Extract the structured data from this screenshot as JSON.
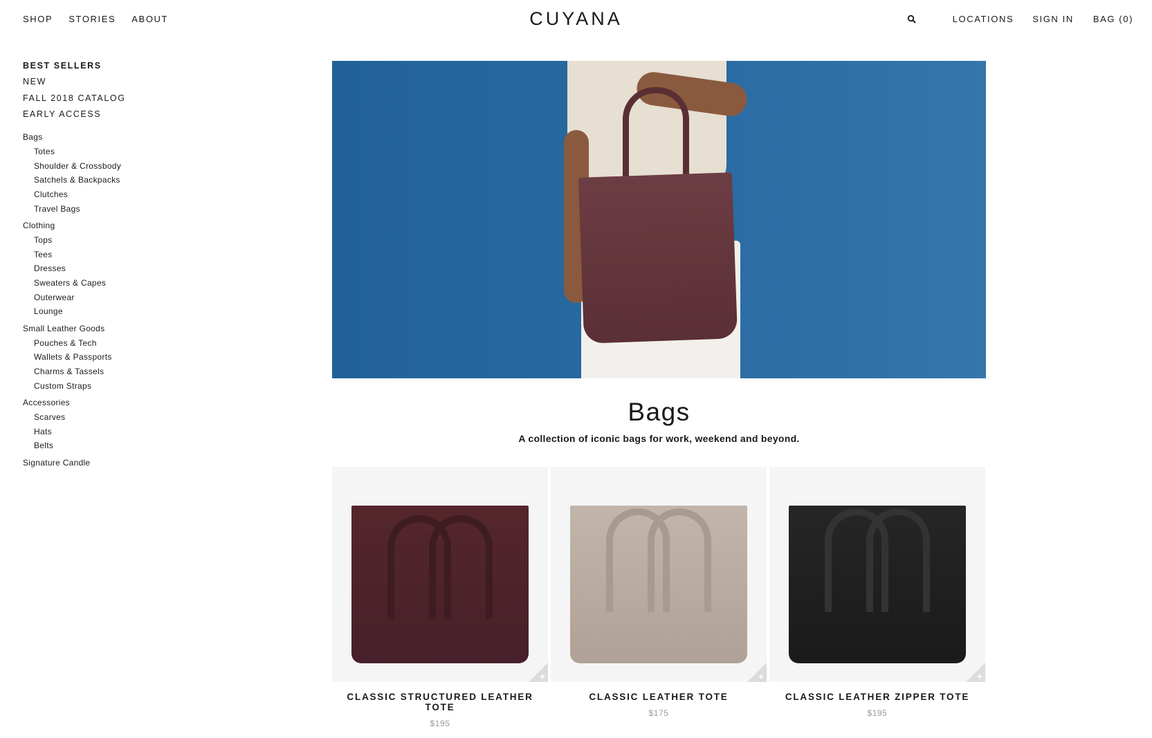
{
  "header": {
    "nav_left": [
      "SHOP",
      "STORIES",
      "ABOUT"
    ],
    "logo": "CUYANA",
    "search_icon": "search-icon",
    "nav_right": [
      "LOCATIONS",
      "SIGN IN",
      "BAG (0)"
    ]
  },
  "sidebar": {
    "featured": [
      "BEST SELLERS",
      "NEW",
      "FALL 2018 CATALOG",
      "EARLY ACCESS"
    ],
    "categories": [
      {
        "label": "Bags",
        "items": [
          "Totes",
          "Shoulder & Crossbody",
          "Satchels & Backpacks",
          "Clutches",
          "Travel Bags"
        ]
      },
      {
        "label": "Clothing",
        "items": [
          "Tops",
          "Tees",
          "Dresses",
          "Sweaters & Capes",
          "Outerwear",
          "Lounge"
        ]
      },
      {
        "label": "Small Leather Goods",
        "items": [
          "Pouches & Tech",
          "Wallets & Passports",
          "Charms & Tassels",
          "Custom Straps"
        ]
      },
      {
        "label": "Accessories",
        "items": [
          "Scarves",
          "Hats",
          "Belts"
        ]
      },
      {
        "label": "Signature Candle",
        "items": []
      }
    ]
  },
  "main": {
    "title": "Bags",
    "subtitle": "A collection of iconic bags for work, weekend and beyond.",
    "products": [
      {
        "name": "CLASSIC STRUCTURED LEATHER TOTE",
        "price": "$195",
        "color": "#4d2328"
      },
      {
        "name": "CLASSIC LEATHER TOTE",
        "price": "$175",
        "color": "#b8aa9f"
      },
      {
        "name": "CLASSIC LEATHER ZIPPER TOTE",
        "price": "$195",
        "color": "#1f1f1f"
      }
    ]
  },
  "colors": {
    "hero_blue": "#2a6ca3",
    "text": "#1a1a1a",
    "price_gray": "#999999",
    "card_bg": "#f5f5f5"
  }
}
